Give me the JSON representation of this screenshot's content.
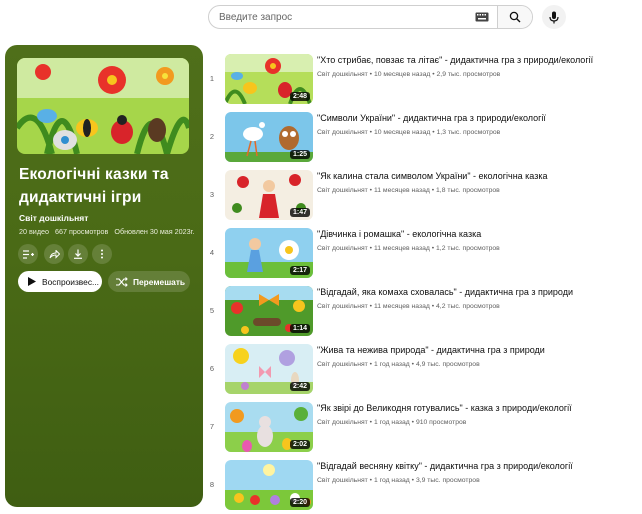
{
  "search": {
    "placeholder": "Введите запрос"
  },
  "playlist": {
    "title": "Екологічні казки та дидактичні ігри",
    "channel": "Світ дошкільнят",
    "video_count": "20 видео",
    "views": "667 просмотров",
    "updated": "Обновлен 30 мая 2023г.",
    "play_label": "Воспроизвес...",
    "shuffle_label": "Перемешать",
    "card_color": "#4a6a16"
  },
  "videos": [
    {
      "index": "1",
      "title": "\"Хто стрибає, повзає та літає\" - дидактична гра з природи/екології",
      "channel": "Світ дошкільнят",
      "age": "10 месяцев назад",
      "views": "2,9 тыс. просмотров",
      "duration": "2:48"
    },
    {
      "index": "2",
      "title": "\"Символи України\" - дидактична гра з природи/екології",
      "channel": "Світ дошкільнят",
      "age": "10 месяцев назад",
      "views": "1,3 тыс. просмотров",
      "duration": "1:25"
    },
    {
      "index": "3",
      "title": "\"Як калина стала символом України\" - екологічна казка",
      "channel": "Світ дошкільнят",
      "age": "11 месяцев назад",
      "views": "1,8 тыс. просмотров",
      "duration": "1:47"
    },
    {
      "index": "4",
      "title": "\"Дівчинка і ромашка\" - екологічна казка",
      "channel": "Світ дошкільнят",
      "age": "11 месяцев назад",
      "views": "1,2 тыс. просмотров",
      "duration": "2:17"
    },
    {
      "index": "5",
      "title": "\"Відгадай, яка комаха сховалась\" - дидактична гра з природи",
      "channel": "Світ дошкільнят",
      "age": "11 месяцев назад",
      "views": "4,2 тыс. просмотров",
      "duration": "1:14"
    },
    {
      "index": "6",
      "title": "\"Жива та нежива природа\" - дидактична гра з природи",
      "channel": "Світ дошкільнят",
      "age": "1 год назад",
      "views": "4,9 тыс. просмотров",
      "duration": "2:42"
    },
    {
      "index": "7",
      "title": "\"Як звірі до Великодня готувались\" - казка з природи/екології",
      "channel": "Світ дошкільнят",
      "age": "1 год назад",
      "views": "910 просмотров",
      "duration": "2:02"
    },
    {
      "index": "8",
      "title": "\"Відгадай весняну квітку\" - дидактична гра з природи/екології",
      "channel": "Світ дошкільнят",
      "age": "1 год назад",
      "views": "3,9 тыс. просмотров",
      "duration": "2:20"
    }
  ]
}
